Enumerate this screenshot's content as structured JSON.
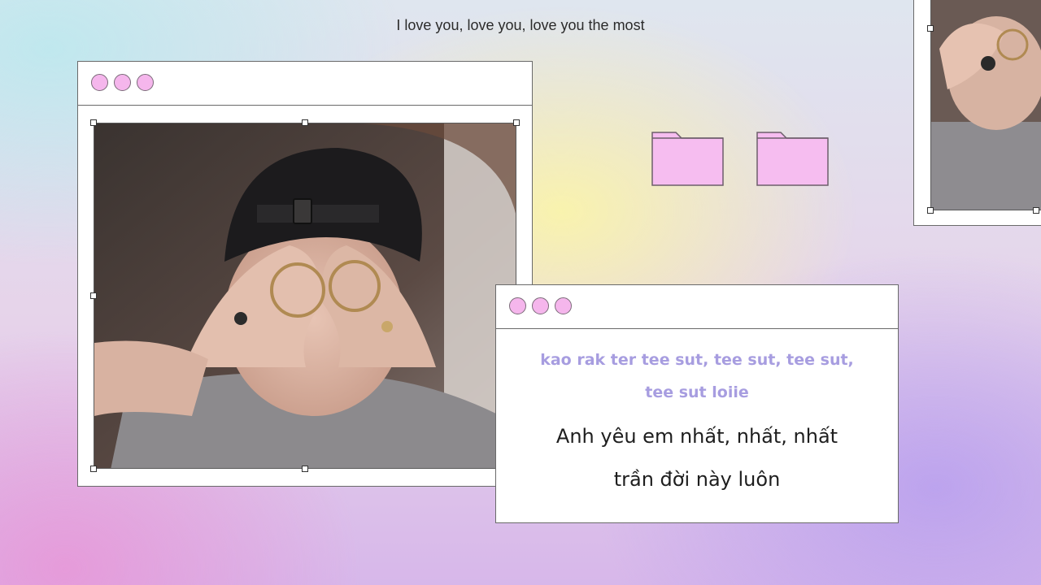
{
  "top_lyric": "I love you, love you, love you the most",
  "photo_window": {
    "traffic_lights": [
      "pink-dot",
      "pink-dot",
      "pink-dot"
    ],
    "image": "photo-person-making-heart-hands"
  },
  "side_window": {
    "image": "photo-person-making-heart-hands-cropped"
  },
  "folders": [
    "folder-icon",
    "folder-icon"
  ],
  "lyric_window": {
    "romanized_line_1": "kao rak ter tee sut, tee sut, tee sut,",
    "romanized_line_2": "tee sut loiie",
    "vietnamese_line_1": "Anh yêu em nhất, nhất, nhất",
    "vietnamese_line_2": "trần đời này luôn"
  },
  "colors": {
    "dot_pink": "#f5b6ec",
    "folder_pink": "#f6bdf0",
    "romanized_text": "#a79de0",
    "window_border": "#6a6a6a"
  }
}
